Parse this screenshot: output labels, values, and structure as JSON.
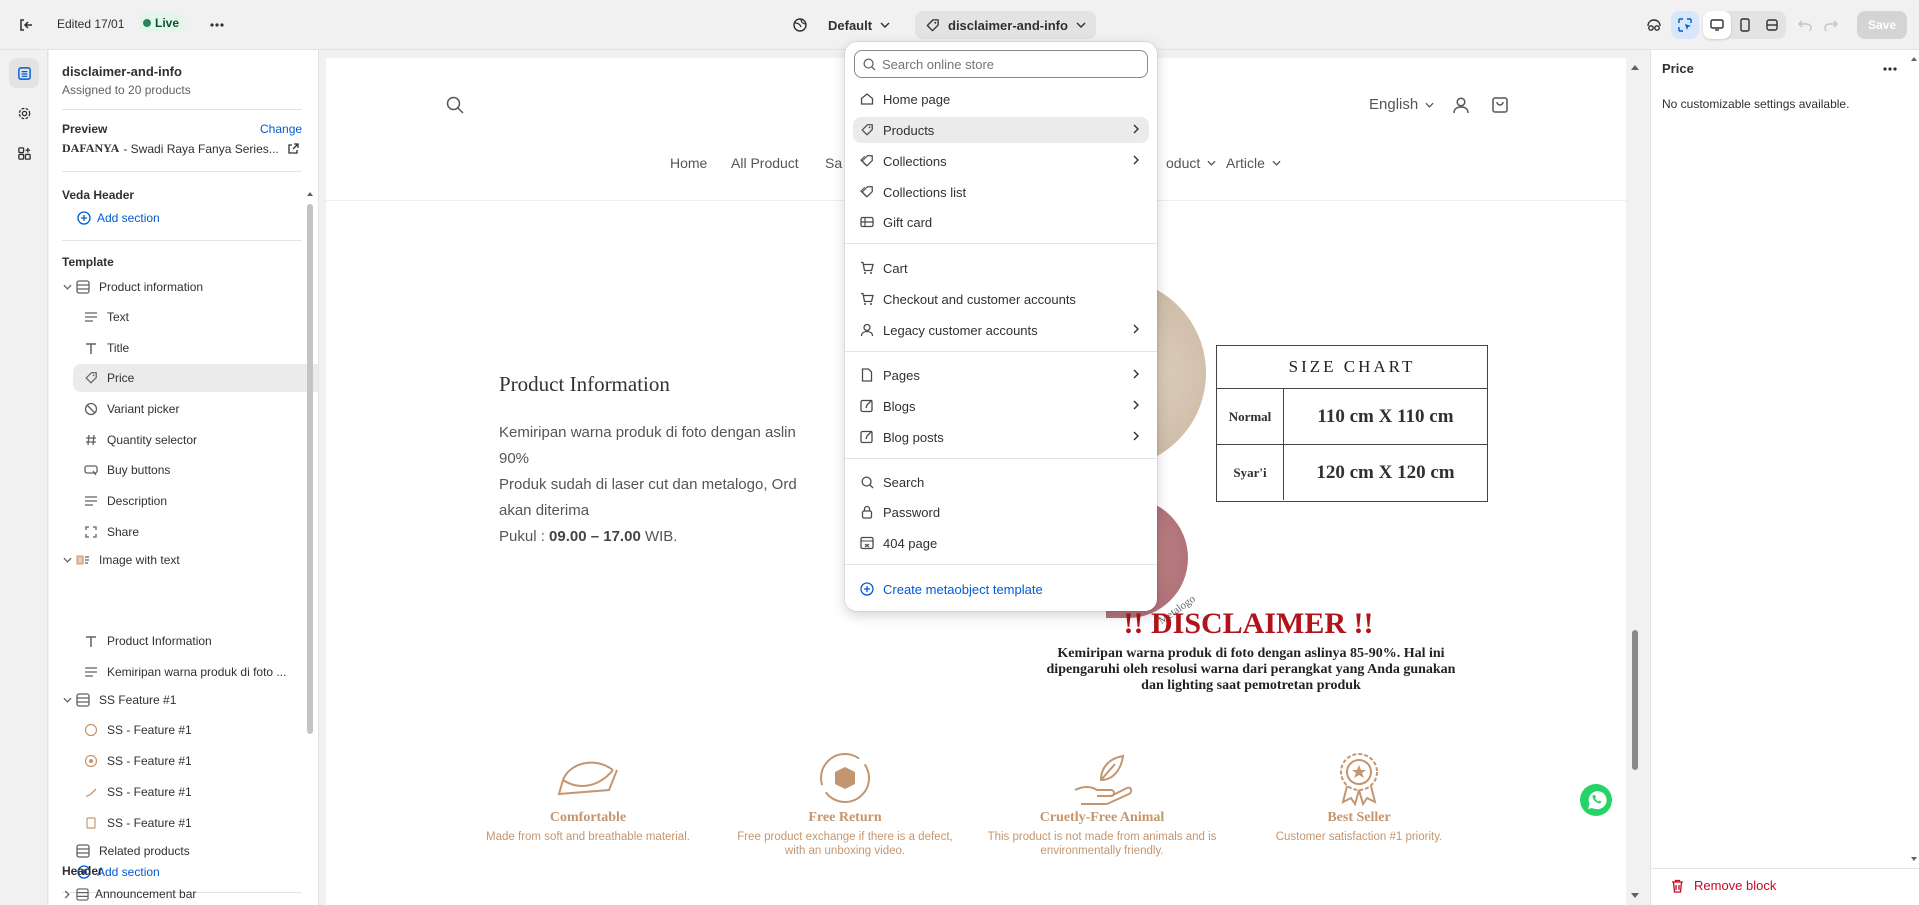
{
  "topbar": {
    "edited": "Edited 17/01",
    "status": "Live",
    "theme_select": "Default",
    "template_select": "disclaimer-and-info",
    "save_label": "Save"
  },
  "sidebar": {
    "template_name": "disclaimer-and-info",
    "assigned": "Assigned to 20 products",
    "preview_label": "Preview",
    "change_label": "Change",
    "preview_brand": "DAFANYA",
    "preview_product": " - Swadi Raya Fanya Series...",
    "veda_header": "Veda Header",
    "add_section": "Add section",
    "template_heading": "Template",
    "product_information": "Product information",
    "pi_blocks": [
      "Text",
      "Title",
      "Price",
      "Variant picker",
      "Quantity selector",
      "Buy buttons",
      "Description",
      "Share"
    ],
    "image_with_text": "Image with text",
    "iwt_blocks": [
      "Product Information",
      "Kemiripan warna produk di foto ..."
    ],
    "ss_feature": "SS Feature #1",
    "ss_blocks": [
      "SS - Feature #1",
      "SS - Feature #1",
      "SS - Feature #1",
      "SS - Feature #1"
    ],
    "related_products": "Related products",
    "header_heading": "Header",
    "announcement_bar": "Announcement bar"
  },
  "storefront": {
    "language": "English",
    "nav": [
      "Home",
      "All Product",
      "Sa",
      "oduct",
      "Article"
    ],
    "product_info_title": "Product Information",
    "para1a": "Kemiripan warna produk di foto dengan aslin",
    "para1b": "90%",
    "para2a": "Produk sudah di laser cut dan metalogo, Ord",
    "para2b": "akan diterima",
    "hours_prefix": "Pukul : ",
    "hours_bold": "09.00 – 17.00",
    "hours_suffix": " WIB.",
    "size_chart": {
      "title": "SIZE CHART",
      "rows": [
        {
          "label": "Normal",
          "size": "110 cm X 110 cm"
        },
        {
          "label": "Syar'i",
          "size": "120 cm X 120 cm"
        }
      ]
    },
    "metalogo": "Metalogo",
    "disclaimer_title": "!! DISCLAIMER !!",
    "disclaimer_text": "Kemiripan warna produk di foto dengan aslinya 85-90%. Hal ini dipengaruhi oleh resolusi warna dari perangkat yang Anda gunakan dan lighting saat pemotretan produk",
    "features": [
      {
        "title": "Comfortable",
        "desc": "Made from soft and breathable material."
      },
      {
        "title": "Free Return",
        "desc": "Free product exchange if there is a defect, with an unboxing video."
      },
      {
        "title": "Cruetly-Free Animal",
        "desc": "This product is not made from animals and is environmentally friendly."
      },
      {
        "title": "Best Seller",
        "desc": "Customer satisfaction #1 priority."
      }
    ]
  },
  "dropdown": {
    "search_placeholder": "Search online store",
    "items": [
      "Home page",
      "Products",
      "Collections",
      "Collections list",
      "Gift card",
      "Cart",
      "Checkout and customer accounts",
      "Legacy customer accounts",
      "Pages",
      "Blogs",
      "Blog posts",
      "Search",
      "Password",
      "404 page"
    ],
    "create_label": "Create metaobject template"
  },
  "rightpanel": {
    "title": "Price",
    "message": "No customizable settings available.",
    "remove_label": "Remove block"
  },
  "colors": {
    "accent": "#005bd3",
    "live_green": "#29845a",
    "disclaimer_red": "#b0141a",
    "feature_tan": "#c49670",
    "remove_red": "#c70a24"
  },
  "icons": [
    "exit-icon",
    "more-icon",
    "theme-icon",
    "tag-icon",
    "inspector-icon",
    "select-icon",
    "desktop-icon",
    "mobile-icon",
    "fullscreen-icon",
    "undo-icon",
    "redo-icon",
    "sections-icon",
    "settings-icon",
    "apps-icon",
    "search-icon",
    "user-icon",
    "cart-icon",
    "whatsapp-icon",
    "trash-icon"
  ]
}
